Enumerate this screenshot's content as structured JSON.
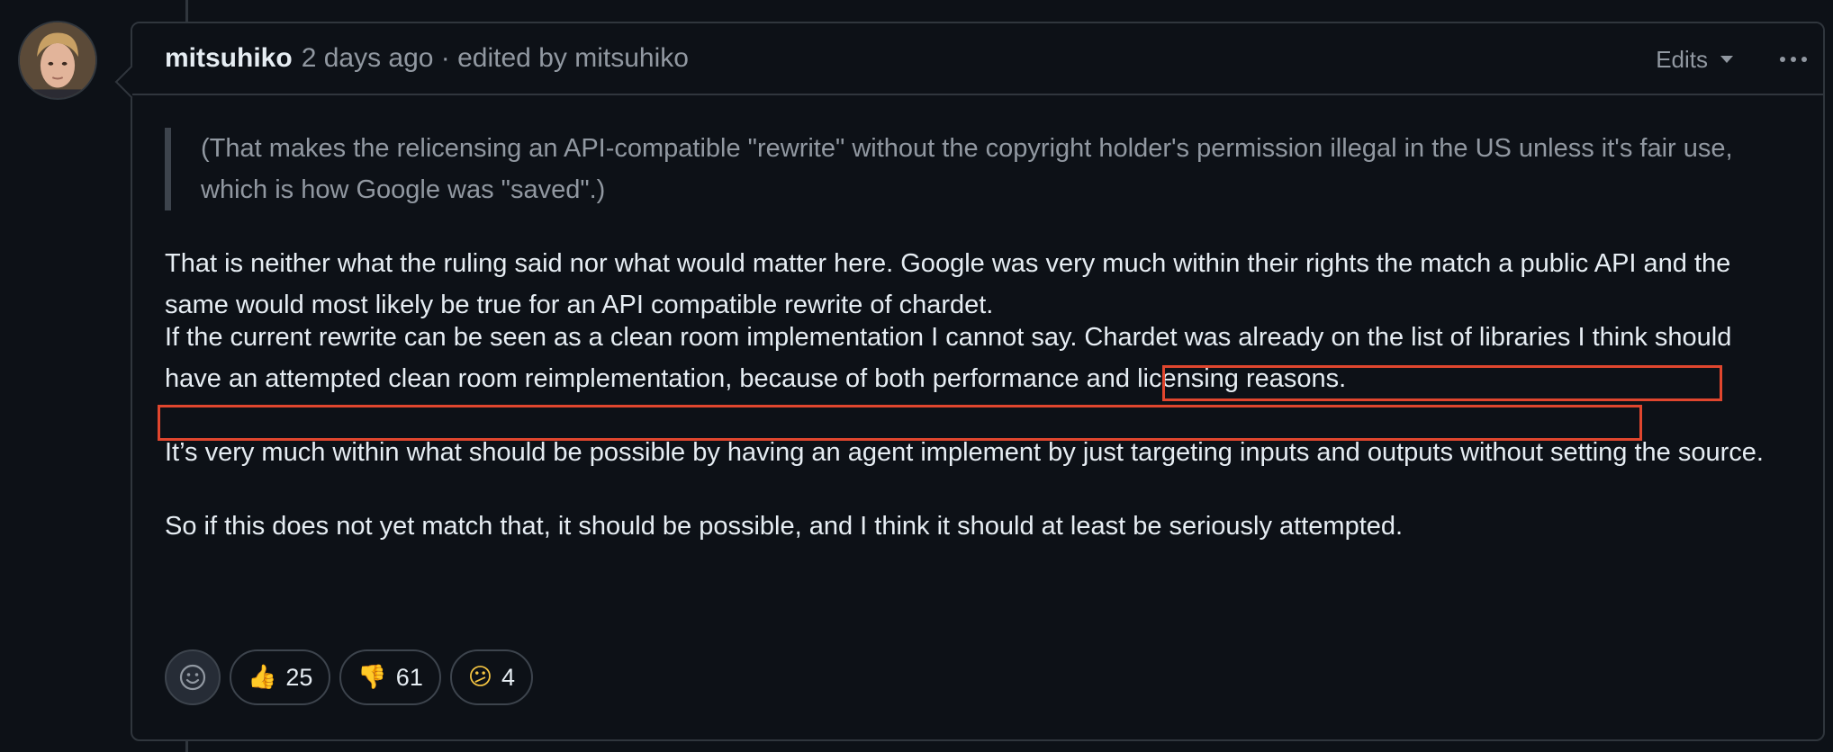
{
  "comment": {
    "author": "mitsuhiko",
    "meta": "2 days ago · edited by mitsuhiko",
    "edits_label": "Edits",
    "quote": "(That makes the relicensing an API-compatible \"rewrite\" without the copyright holder's permission illegal in the US unless it's fair use, which is how Google was \"saved\".)",
    "paragraphs": [
      "That is neither what the ruling said nor what would matter here. Google was very much within their rights the match a public API and the same would most likely be true for an API compatible rewrite of chardet.",
      "If the current rewrite can be seen as a clean room implementation I cannot say. Chardet was already on the list of libraries I think should have an attempted clean room reimplementation, because of both performance and licensing reasons.",
      "It’s very much within what should be possible by having an agent implement by just targeting inputs and outputs without setting the source.",
      "So if this does not yet match that, it should be possible, and I think it should at least be seriously attempted."
    ]
  },
  "reactions": [
    {
      "icon": "thumbs-up-icon",
      "emoji": "👍",
      "count": "25"
    },
    {
      "icon": "thumbs-down-icon",
      "emoji": "👎",
      "count": "61"
    },
    {
      "icon": "confused-face-icon",
      "emoji": "😕",
      "count": "4"
    }
  ],
  "colors": {
    "background": "#0d1117",
    "border": "#30363d",
    "muted_text": "#9198a1",
    "text": "#e6edf3",
    "highlight_box": "#e0462e"
  }
}
